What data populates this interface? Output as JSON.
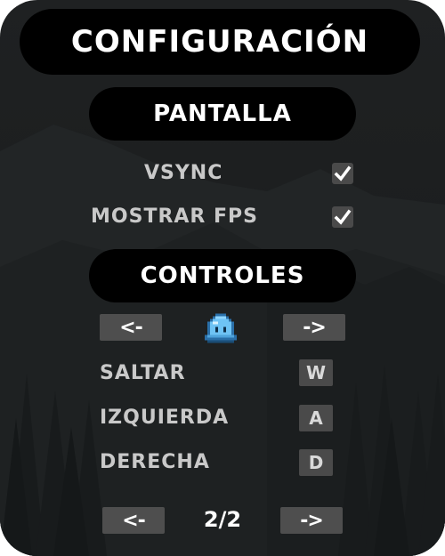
{
  "title": "CONFIGURACIÓN",
  "display_section": {
    "heading": "PANTALLA",
    "options": [
      {
        "label": "VSYNC",
        "checked": true
      },
      {
        "label": "MOSTRAR FPS",
        "checked": true
      }
    ]
  },
  "controls_section": {
    "heading": "CONTROLES",
    "prev_label": "<-",
    "next_label": "->",
    "character_icon": "slime-icon",
    "bindings": [
      {
        "action": "SALTAR",
        "key": "W"
      },
      {
        "action": "IZQUIERDA",
        "key": "A"
      },
      {
        "action": "DERECHA",
        "key": "D"
      }
    ]
  },
  "pagination": {
    "prev_label": "<-",
    "page": "2/2",
    "next_label": "->"
  },
  "colors": {
    "panel_bg": "#1f2122",
    "pill_bg": "#000000",
    "button_bg": "#4e4e4e",
    "label_text": "#c9c9c9",
    "slime": "#6ec3f4"
  }
}
